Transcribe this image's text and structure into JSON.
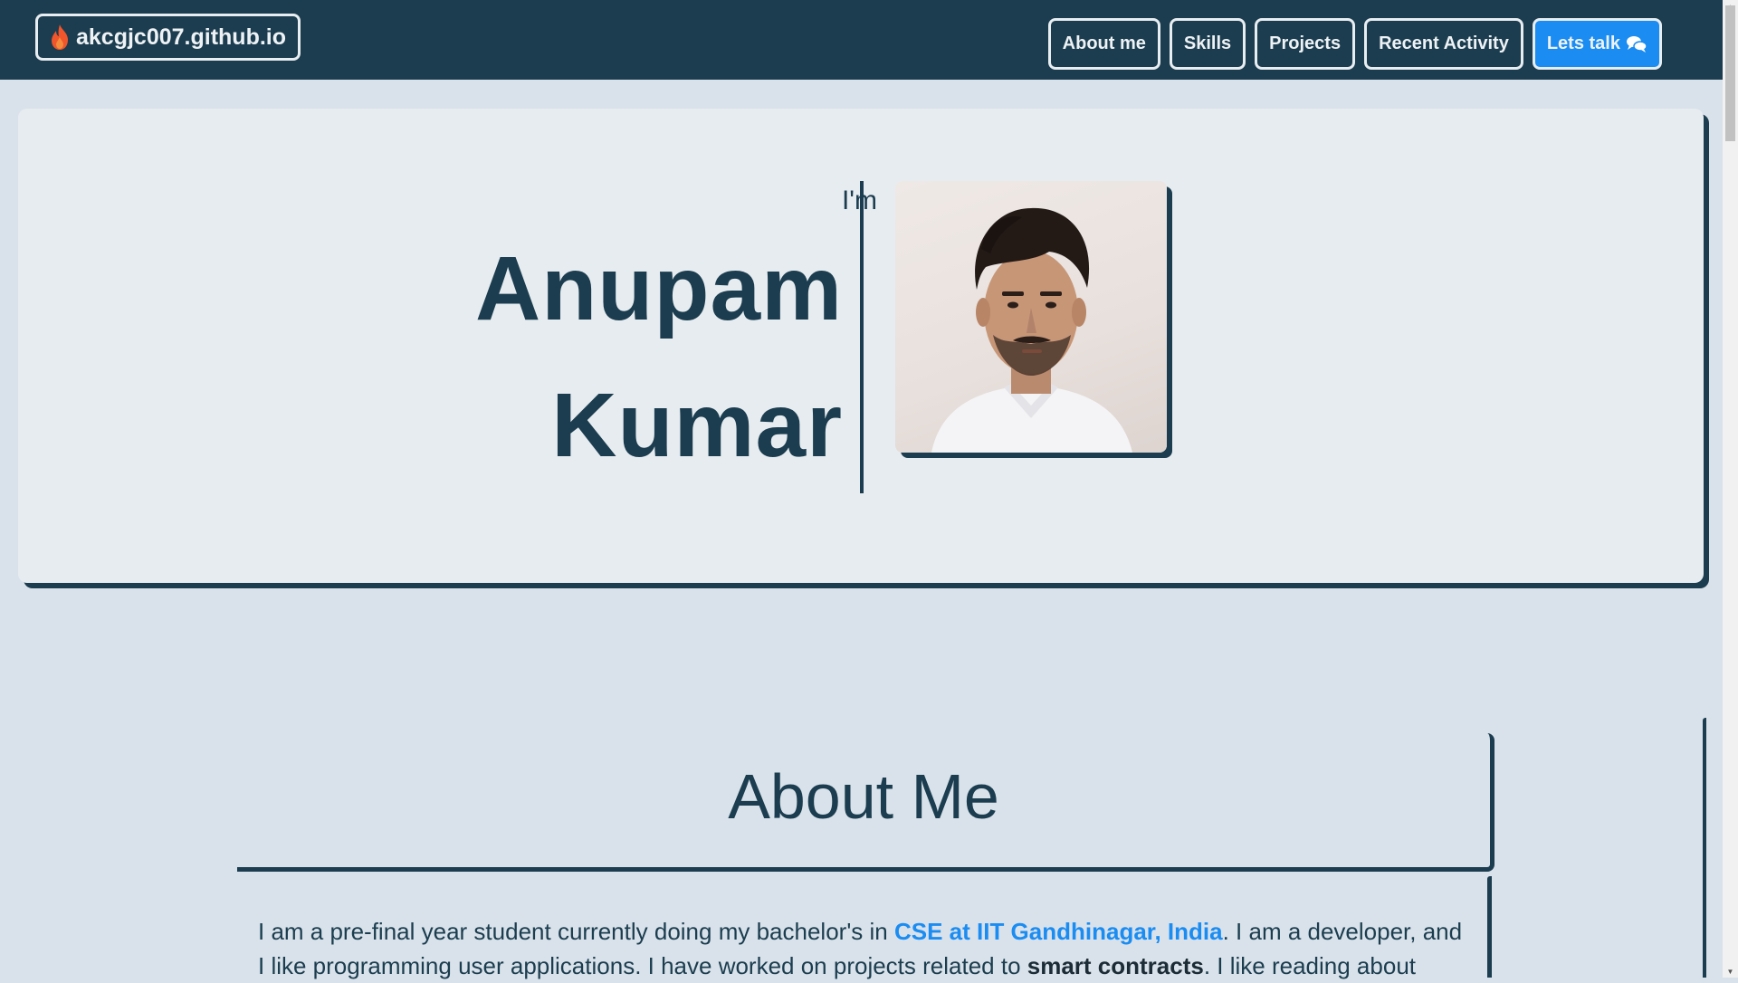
{
  "navbar": {
    "brand_label": "akcgjc007.github.io",
    "brand_icon": "flame-icon",
    "links": [
      {
        "label": "About me"
      },
      {
        "label": "Skills"
      },
      {
        "label": "Projects"
      },
      {
        "label": "Recent Activity"
      }
    ],
    "cta_label": "Lets talk",
    "cta_icon": "chat-icon"
  },
  "hero": {
    "intro": "I'm",
    "first_name": "Anupam",
    "last_name": "Kumar",
    "photo_icon": "profile-photo"
  },
  "about": {
    "title": "About Me",
    "text_1": "I am a pre-final year student currently doing my bachelor's in ",
    "link": "CSE at IIT Gandhinagar, India",
    "text_2": ". I am a developer, and I like programming user applications. I have worked on projects related to ",
    "bold": "smart contracts",
    "text_3": ". I like reading about"
  },
  "colors": {
    "primary": "#1b3d4f",
    "accent": "#1a8cf2",
    "background": "#d9e2ea",
    "card": "#e7ecf0"
  }
}
